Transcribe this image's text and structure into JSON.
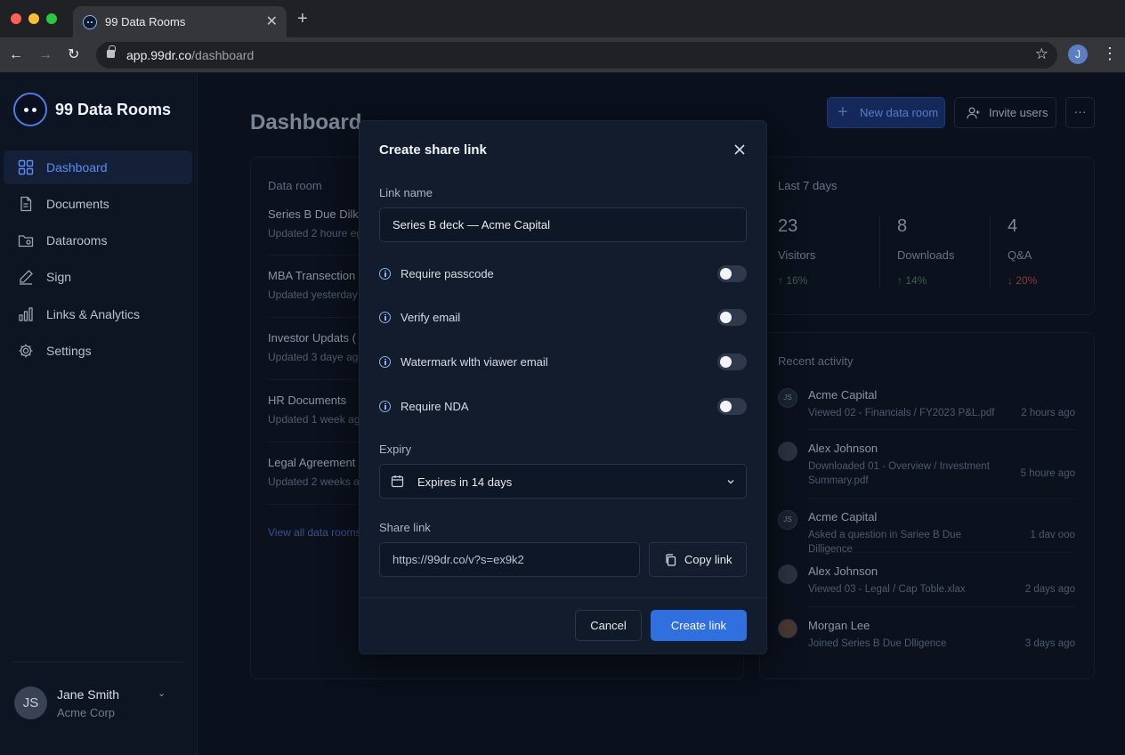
{
  "browser": {
    "tab_title": "99 Data Rooms",
    "url_host": "app.99dr.co",
    "url_path": "/dashboard",
    "profile_initial": "J"
  },
  "sidebar": {
    "brand": "99 Data Rooms",
    "items": [
      {
        "label": "Dashboard",
        "icon": "grid-icon",
        "active": true
      },
      {
        "label": "Documents",
        "icon": "document-icon"
      },
      {
        "label": "Datarooms",
        "icon": "folder-icon"
      },
      {
        "label": "Sign",
        "icon": "pen-icon"
      },
      {
        "label": "Links & Analytics",
        "icon": "bar-chart-icon"
      },
      {
        "label": "Settings",
        "icon": "gear-icon"
      }
    ],
    "user": {
      "initials": "JS",
      "name": "Jane Smith",
      "org": "Acme Corp"
    }
  },
  "header": {
    "title": "Dashboard",
    "new_room_label": "New data room",
    "invite_label": "Invite users",
    "more_label": "···"
  },
  "rooms": {
    "heading": "Data room",
    "list": [
      {
        "name": "Series B Due Dilk",
        "updated": "Updated 2 houre eg"
      },
      {
        "name": "MBA Transection",
        "updated": "Updated yesterday"
      },
      {
        "name": "Investor Updats (",
        "updated": "Updated 3 daye ago"
      },
      {
        "name": "HR Documents",
        "updated": "Updated 1 week ago"
      },
      {
        "name": "Legal Agreement",
        "updated": "Updated 2 weeks ag"
      }
    ],
    "view_all": "View all data rooms"
  },
  "stats": {
    "heading": "Last 7 days",
    "items": [
      {
        "value": "23",
        "label": "Visitors",
        "delta": "↑ 16%",
        "trend": "up"
      },
      {
        "value": "8",
        "label": "Downloads",
        "delta": "↑ 14%",
        "trend": "up"
      },
      {
        "value": "4",
        "label": "Q&A",
        "delta": "↓ 20%",
        "trend": "down"
      }
    ]
  },
  "activity": {
    "heading": "Recent activity",
    "items": [
      {
        "who": "Acme Capital",
        "avatar": "JS",
        "what": "Viewed 02 - Financials / FY2023 P&L.pdf",
        "when": "2 hours ago"
      },
      {
        "who": "Alex Johnson",
        "avatar": "",
        "what": "Downloaded 01 - Overview / Investment Summary.pdf",
        "when": "5 houre ago"
      },
      {
        "who": "Acme Capital",
        "avatar": "JS",
        "what": "Asked a question in Sariee B Due Dilligence",
        "when": "1 dav ooo"
      },
      {
        "who": "Alex Johnson",
        "avatar": "",
        "what": "Viewed 03 - Legal / Cap Toble.xlax",
        "when": "2 days ago"
      },
      {
        "who": "Morgan Lee",
        "avatar": "",
        "what": "Joined Series B Due Dlligence",
        "when": "3 days ago"
      }
    ]
  },
  "modal": {
    "title": "Create share link",
    "link_name_label": "Link name",
    "link_name_value": "Series B deck — Acme Capital",
    "options": [
      {
        "label": "Require passcode",
        "enabled": false
      },
      {
        "label": "Verify email",
        "enabled": false
      },
      {
        "label": "Watermark wlth viawer email",
        "enabled": false
      },
      {
        "label": "Require NDA",
        "enabled": false
      }
    ],
    "expiry_label": "Expiry",
    "expiry_value": "Expires in 14 days",
    "share_link_label": "Share link",
    "share_link_value": "https://99dr.co/v?s=ex9k2",
    "copy_label": "Copy link",
    "cancel_label": "Cancel",
    "create_label": "Create link"
  },
  "colors": {
    "accent": "#2f6fe0",
    "background": "#0b1220",
    "modal": "#121c2c"
  }
}
